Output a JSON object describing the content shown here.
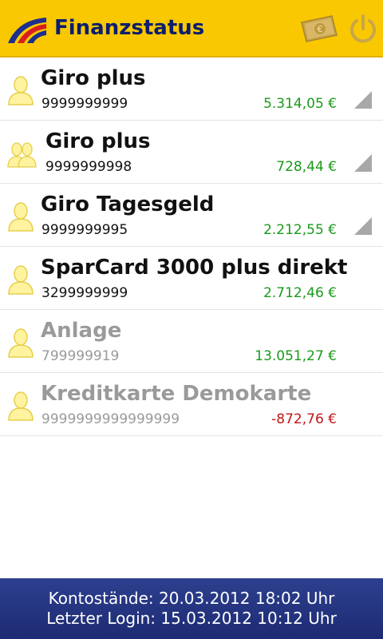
{
  "header": {
    "title": "Finanzstatus",
    "money_icon": "banknote-euro-icon",
    "power_icon": "power-icon"
  },
  "colors": {
    "header_bg": "#f9c800",
    "title_color": "#0c1e6e",
    "positive_amount": "#1a9a1a",
    "negative_amount": "#c41414",
    "inactive_text": "#9a9a9a",
    "footer_bg": "#233383"
  },
  "accounts": [
    {
      "name": "Giro plus",
      "number": "9999999999",
      "amount": "5.314,05 €",
      "sign": "positive",
      "icon": "single-person-icon",
      "expandable": true,
      "active": true
    },
    {
      "name": "Giro plus",
      "number": "9999999998",
      "amount": "728,44 €",
      "sign": "positive",
      "icon": "group-person-icon",
      "expandable": true,
      "active": true
    },
    {
      "name": "Giro Tagesgeld",
      "number": "9999999995",
      "amount": "2.212,55 €",
      "sign": "positive",
      "icon": "single-person-icon",
      "expandable": true,
      "active": true
    },
    {
      "name": "SparCard 3000 plus direkt",
      "number": "3299999999",
      "amount": "2.712,46 €",
      "sign": "positive",
      "icon": "single-person-icon",
      "expandable": false,
      "active": true
    },
    {
      "name": "Anlage",
      "number": "799999919",
      "amount": "13.051,27 €",
      "sign": "positive",
      "icon": "single-person-icon",
      "expandable": false,
      "active": false
    },
    {
      "name": "Kreditkarte Demokarte",
      "number": "9999999999999999",
      "amount": "-872,76 €",
      "sign": "negative",
      "icon": "single-person-icon",
      "expandable": false,
      "active": false
    }
  ],
  "footer": {
    "balances_line": "Kontostände: 20.03.2012 18:02 Uhr",
    "login_line": "Letzter Login: 15.03.2012 10:12 Uhr"
  }
}
